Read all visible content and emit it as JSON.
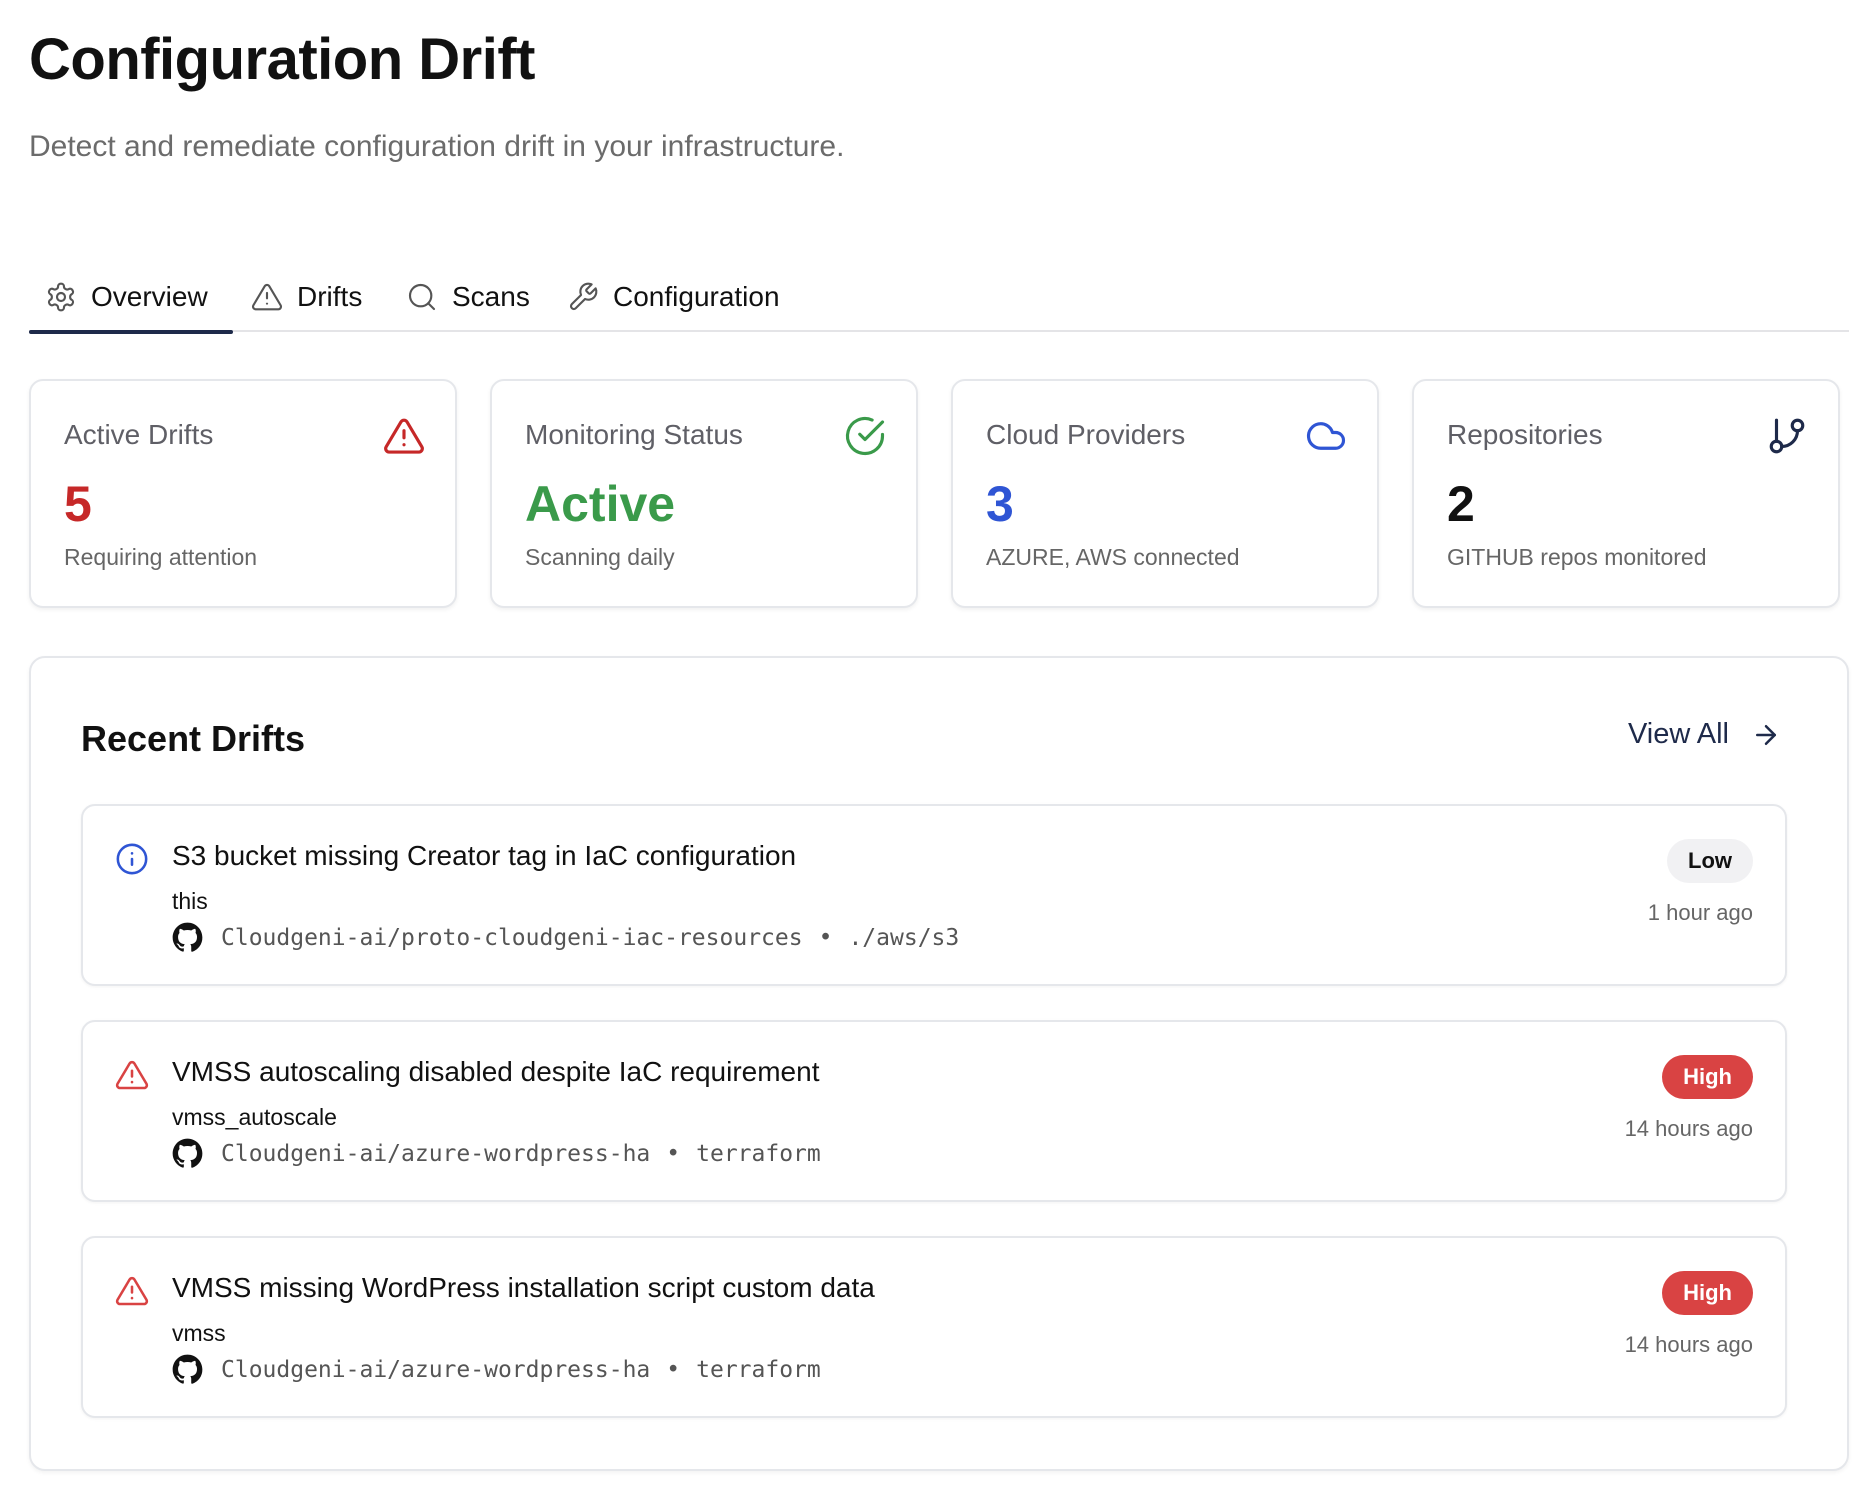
{
  "header": {
    "title": "Configuration Drift",
    "subtitle": "Detect and remediate configuration drift in your infrastructure."
  },
  "tabs": [
    {
      "label": "Overview",
      "icon": "gear-icon",
      "active": true
    },
    {
      "label": "Drifts",
      "icon": "warning-icon",
      "active": false
    },
    {
      "label": "Scans",
      "icon": "search-icon",
      "active": false
    },
    {
      "label": "Configuration",
      "icon": "wrench-icon",
      "active": false
    }
  ],
  "cards": [
    {
      "label": "Active Drifts",
      "value": "5",
      "note": "Requiring attention",
      "icon": "warning-icon",
      "color": "#c62828"
    },
    {
      "label": "Monitoring Status",
      "value": "Active",
      "note": "Scanning daily",
      "icon": "check-circle-icon",
      "color": "#3a9a4a"
    },
    {
      "label": "Cloud Providers",
      "value": "3",
      "note": "AZURE, AWS connected",
      "icon": "cloud-icon",
      "color": "#2f55d4"
    },
    {
      "label": "Repositories",
      "value": "2",
      "note": "GITHUB repos monitored",
      "icon": "git-branch-icon",
      "color": "#111111"
    }
  ],
  "recent": {
    "title": "Recent Drifts",
    "view_all": "View All",
    "items": [
      {
        "severity": "Low",
        "icon": "info-icon",
        "title": "S3 bucket missing Creator tag in IaC configuration",
        "resource": "this",
        "repo": "Cloudgeni-ai/proto-cloudgeni-iac-resources",
        "separator": "•",
        "path": "./aws/s3",
        "time": "1 hour ago"
      },
      {
        "severity": "High",
        "icon": "warning-icon",
        "title": "VMSS autoscaling disabled despite IaC requirement",
        "resource": "vmss_autoscale",
        "repo": "Cloudgeni-ai/azure-wordpress-ha",
        "separator": "•",
        "path": "terraform",
        "time": "14 hours ago"
      },
      {
        "severity": "High",
        "icon": "warning-icon",
        "title": "VMSS missing WordPress installation script custom data",
        "resource": "vmss",
        "repo": "Cloudgeni-ai/azure-wordpress-ha",
        "separator": "•",
        "path": "terraform",
        "time": "14 hours ago"
      }
    ]
  },
  "colors": {
    "accent": "#1e2a4a",
    "danger": "#d94343",
    "info": "#2f55d4",
    "success": "#3a9a4a"
  }
}
